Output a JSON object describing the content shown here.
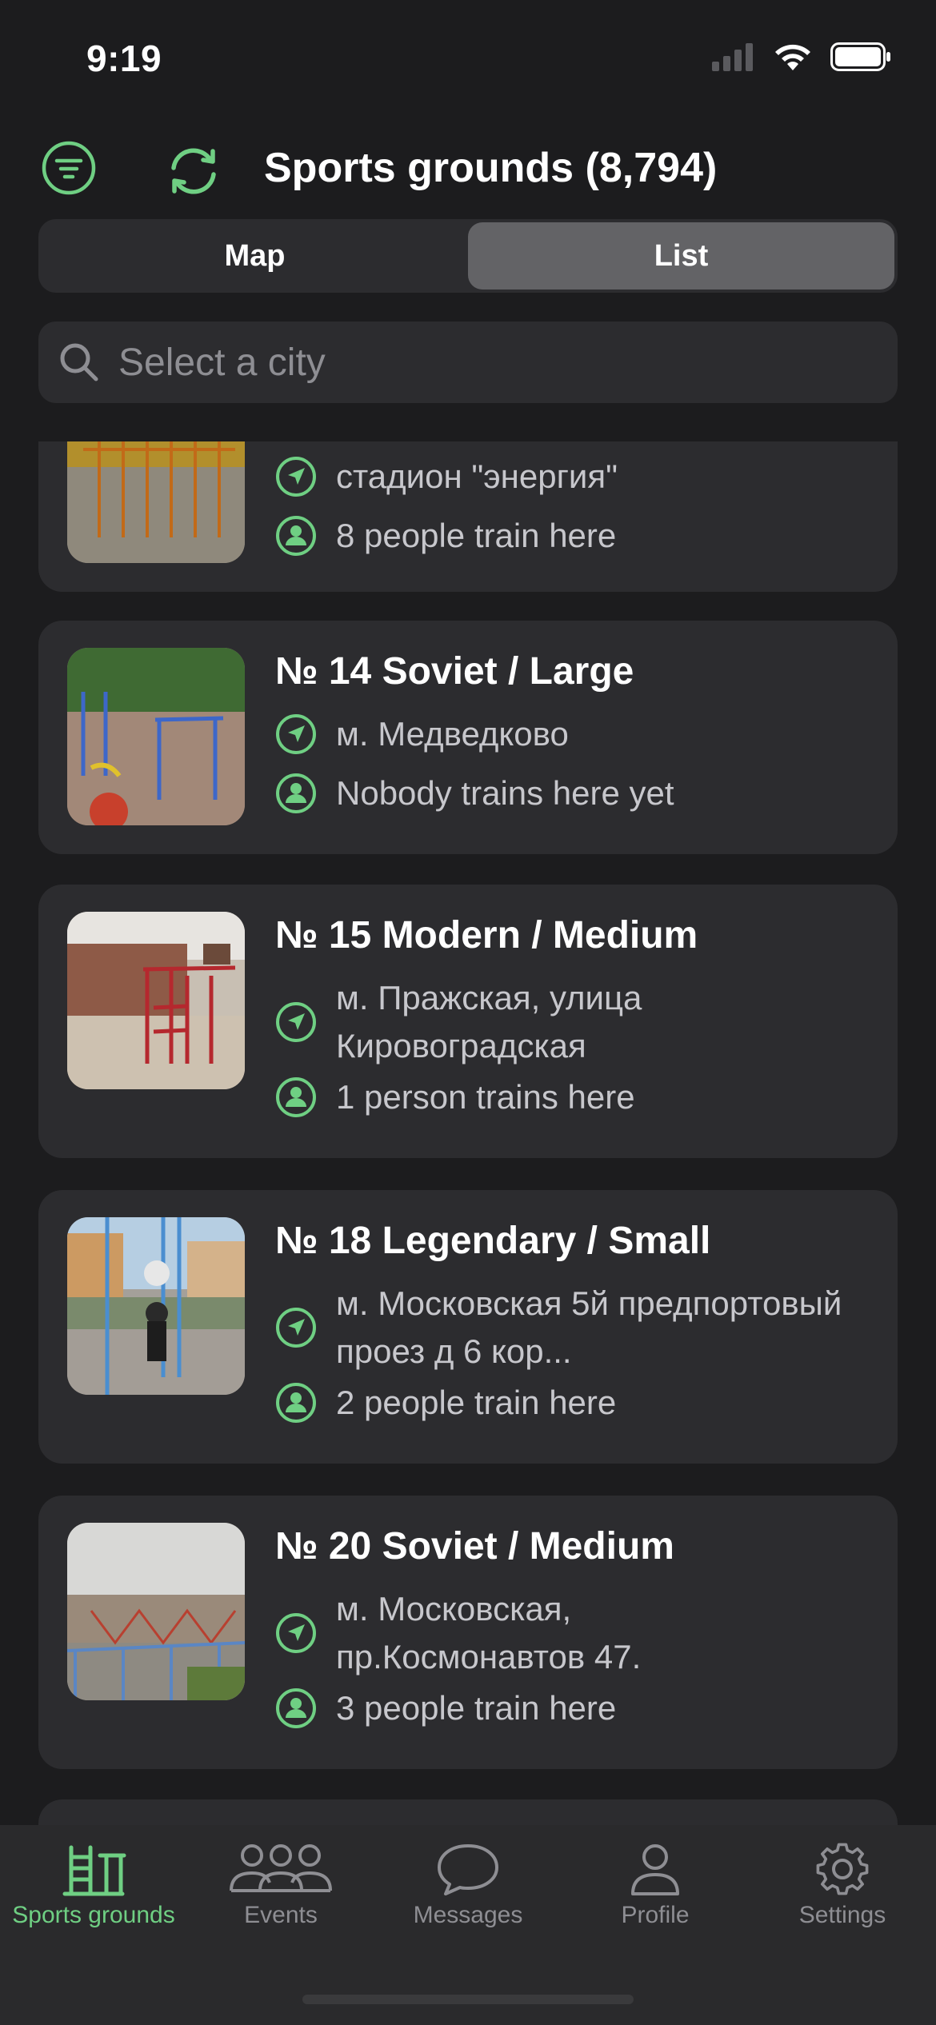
{
  "status": {
    "time": "9:19"
  },
  "header": {
    "title": "Sports grounds (8,794)"
  },
  "segmented": {
    "map_label": "Map",
    "list_label": "List",
    "selected": "List"
  },
  "search": {
    "placeholder": "Select a city"
  },
  "colors": {
    "accent": "#6fcf83",
    "background": "#1c1c1e",
    "card": "#2c2c2f",
    "secondary_text": "#c7c7cc"
  },
  "grounds": [
    {
      "title": "",
      "location": "стадион \"энергия\"",
      "people": "8 people train here"
    },
    {
      "title": "№ 14 Soviet / Large",
      "location": "м. Медведково",
      "people": "Nobody trains here yet"
    },
    {
      "title": "№ 15 Modern / Medium",
      "location": "м. Пражская, улица Кировоградская",
      "people": "1 person trains here"
    },
    {
      "title": "№ 18 Legendary / Small",
      "location": "м. Московская 5й предпортовый проез д 6 кор...",
      "people": "2 people train here"
    },
    {
      "title": "№ 20 Soviet / Medium",
      "location": "м. Московская, пр.Космонавтов 47.",
      "people": "3 people train here"
    }
  ],
  "tabbar": {
    "items": [
      {
        "label": "Sports grounds",
        "icon": "sports-ground-icon",
        "active": true
      },
      {
        "label": "Events",
        "icon": "people-group-icon",
        "active": false
      },
      {
        "label": "Messages",
        "icon": "chat-bubble-icon",
        "active": false
      },
      {
        "label": "Profile",
        "icon": "person-icon",
        "active": false
      },
      {
        "label": "Settings",
        "icon": "gear-icon",
        "active": false
      }
    ]
  }
}
